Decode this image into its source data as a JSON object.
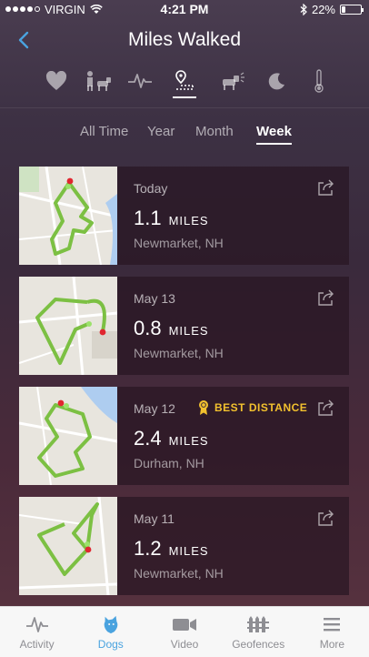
{
  "status_bar": {
    "carrier": "VIRGIN",
    "time": "4:21 PM",
    "battery": "22%",
    "battery_level": 0.22
  },
  "header": {
    "title": "Miles Walked",
    "back_icon": "chevron-left-icon"
  },
  "metric_icons": [
    {
      "name": "heart-icon",
      "active": false
    },
    {
      "name": "dog-training-icon",
      "active": false
    },
    {
      "name": "activity-pulse-icon",
      "active": false
    },
    {
      "name": "map-route-icon",
      "active": true
    },
    {
      "name": "dog-bark-icon",
      "active": false
    },
    {
      "name": "moon-icon",
      "active": false
    },
    {
      "name": "thermometer-icon",
      "active": false
    }
  ],
  "range_tabs": [
    {
      "label": "All Time",
      "active": false
    },
    {
      "label": "Year",
      "active": false
    },
    {
      "label": "Month",
      "active": false
    },
    {
      "label": "Week",
      "active": true
    }
  ],
  "walks": [
    {
      "date": "Today",
      "distance": "1.1",
      "unit": "MILES",
      "location": "Newmarket, NH",
      "badge": ""
    },
    {
      "date": "May 13",
      "distance": "0.8",
      "unit": "MILES",
      "location": "Newmarket, NH",
      "badge": ""
    },
    {
      "date": "May 12",
      "distance": "2.4",
      "unit": "MILES",
      "location": "Durham, NH",
      "badge": "BEST DISTANCE"
    },
    {
      "date": "May 11",
      "distance": "1.2",
      "unit": "MILES",
      "location": "Newmarket, NH",
      "badge": ""
    }
  ],
  "tab_bar": [
    {
      "label": "Activity",
      "icon": "activity-icon",
      "active": false
    },
    {
      "label": "Dogs",
      "icon": "dog-icon",
      "active": true
    },
    {
      "label": "Video",
      "icon": "video-camera-icon",
      "active": false
    },
    {
      "label": "Geofences",
      "icon": "fence-icon",
      "active": false
    },
    {
      "label": "More",
      "icon": "menu-icon",
      "active": false
    }
  ],
  "colors": {
    "accent": "#4aa3df",
    "route": "#7cc043",
    "badge": "#f2c12e"
  }
}
